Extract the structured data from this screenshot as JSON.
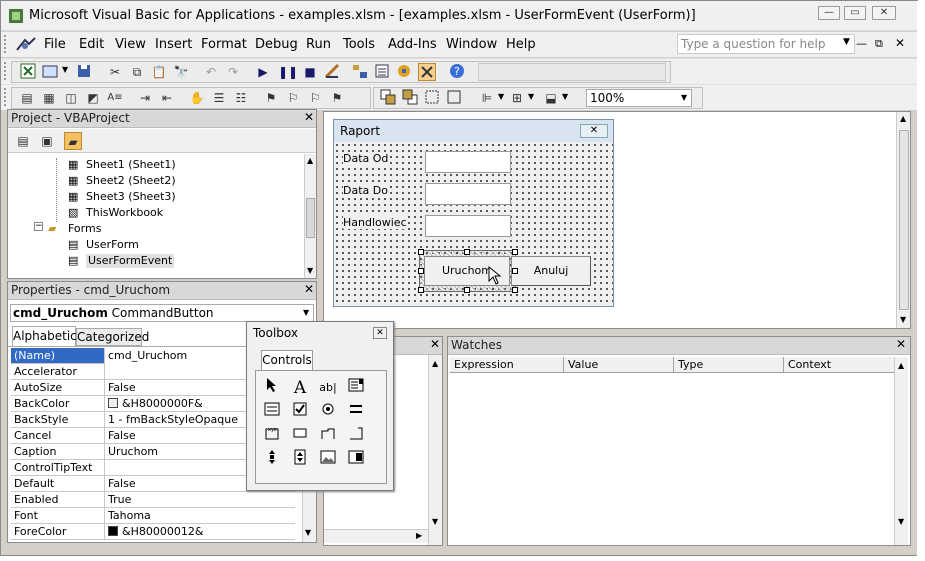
{
  "window": {
    "title": "Microsoft Visual Basic for Applications - examples.xlsm - [examples.xlsm - UserFormEvent (UserForm)]"
  },
  "menu": {
    "items": [
      "File",
      "Edit",
      "View",
      "Insert",
      "Format",
      "Debug",
      "Run",
      "Tools",
      "Add-Ins",
      "Window",
      "Help"
    ],
    "help_placeholder": "Type a question for help"
  },
  "toolbar": {
    "zoom": "100%"
  },
  "project": {
    "title": "Project - VBAProject",
    "tree": [
      "Sheet1 (Sheet1)",
      "Sheet2 (Sheet2)",
      "Sheet3 (Sheet3)",
      "ThisWorkbook",
      "Forms",
      "UserForm",
      "UserFormEvent"
    ]
  },
  "properties": {
    "title": "Properties - cmd_Uruchom",
    "object_name": "cmd_Uruchom",
    "object_type": "CommandButton",
    "tabs": [
      "Alphabetic",
      "Categorized"
    ],
    "rows": [
      {
        "name": "(Name)",
        "value": "cmd_Uruchom"
      },
      {
        "name": "Accelerator",
        "value": ""
      },
      {
        "name": "AutoSize",
        "value": "False"
      },
      {
        "name": "BackColor",
        "value": "&H8000000F&"
      },
      {
        "name": "BackStyle",
        "value": "1 - fmBackStyleOpaque"
      },
      {
        "name": "Cancel",
        "value": "False"
      },
      {
        "name": "Caption",
        "value": "Uruchom"
      },
      {
        "name": "ControlTipText",
        "value": ""
      },
      {
        "name": "Default",
        "value": "False"
      },
      {
        "name": "Enabled",
        "value": "True"
      },
      {
        "name": "Font",
        "value": "Tahoma"
      },
      {
        "name": "ForeColor",
        "value": "&H80000012&"
      }
    ]
  },
  "userform": {
    "caption": "Raport",
    "labels": [
      "Data Od",
      "Data Do",
      "Handlowiec"
    ],
    "buttons": [
      "Uruchom",
      "Anuluj"
    ]
  },
  "toolbox": {
    "title": "Toolbox",
    "tab": "Controls"
  },
  "watches": {
    "title": "Watches",
    "columns": [
      "Expression",
      "Value",
      "Type",
      "Context"
    ]
  },
  "colors": {
    "selection": "#316ac5",
    "titlebar": "#f0f0f0",
    "chrome": "#d4d0c8"
  }
}
